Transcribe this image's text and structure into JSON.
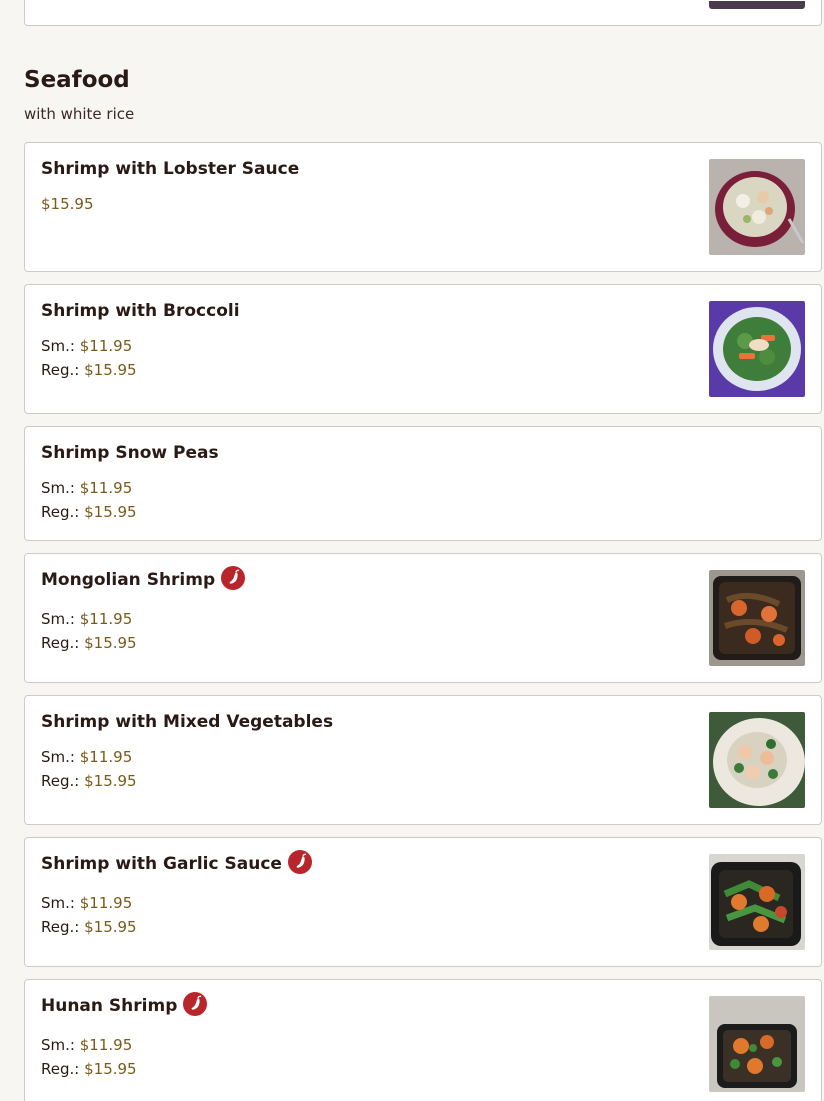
{
  "section": {
    "title": "Seafood",
    "subtitle": "with white rice"
  },
  "items": [
    {
      "name": "Shrimp with Lobster Sauce",
      "price": "$15.95",
      "spicy": false,
      "image": "shrimp-lobster-sauce-photo"
    },
    {
      "name": "Shrimp with Broccoli",
      "sizes": [
        {
          "label": "Sm.:",
          "price": "$11.95"
        },
        {
          "label": "Reg.:",
          "price": "$15.95"
        }
      ],
      "spicy": false,
      "image": "shrimp-broccoli-photo"
    },
    {
      "name": "Shrimp Snow Peas",
      "sizes": [
        {
          "label": "Sm.:",
          "price": "$11.95"
        },
        {
          "label": "Reg.:",
          "price": "$15.95"
        }
      ],
      "spicy": false
    },
    {
      "name": "Mongolian Shrimp",
      "sizes": [
        {
          "label": "Sm.:",
          "price": "$11.95"
        },
        {
          "label": "Reg.:",
          "price": "$15.95"
        }
      ],
      "spicy": true,
      "image": "mongolian-shrimp-photo"
    },
    {
      "name": "Shrimp with Mixed Vegetables",
      "sizes": [
        {
          "label": "Sm.:",
          "price": "$11.95"
        },
        {
          "label": "Reg.:",
          "price": "$15.95"
        }
      ],
      "spicy": false,
      "image": "shrimp-mixed-vegetables-photo"
    },
    {
      "name": "Shrimp with Garlic Sauce",
      "sizes": [
        {
          "label": "Sm.:",
          "price": "$11.95"
        },
        {
          "label": "Reg.:",
          "price": "$15.95"
        }
      ],
      "spicy": true,
      "image": "shrimp-garlic-sauce-photo"
    },
    {
      "name": "Hunan Shrimp",
      "sizes": [
        {
          "label": "Sm.:",
          "price": "$11.95"
        },
        {
          "label": "Reg.:",
          "price": "$15.95"
        }
      ],
      "spicy": true,
      "image": "hunan-shrimp-photo"
    }
  ],
  "icons": {
    "spicy": "chili-pepper-icon"
  },
  "colors": {
    "price": "#7a5a1a",
    "spicy_badge": "#b8262b",
    "background": "#f8f6f3"
  }
}
